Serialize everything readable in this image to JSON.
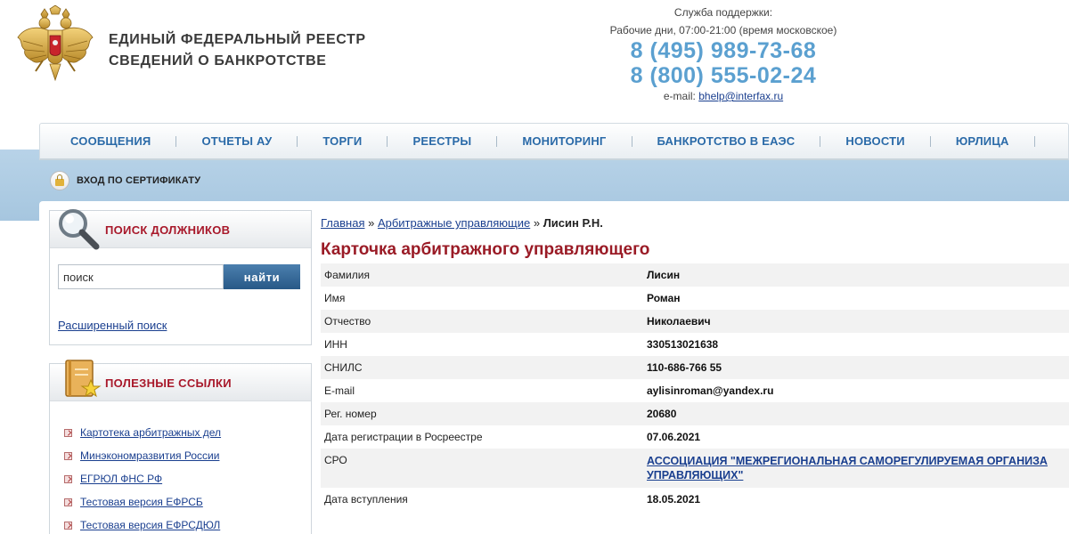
{
  "header": {
    "title_line1": "ЕДИНЫЙ  ФЕДЕРАЛЬНЫЙ  РЕЕСТР",
    "title_line2": "СВЕДЕНИЙ О БАНКРОТСТВЕ",
    "emblem_icon": "double-headed-eagle-icon"
  },
  "support": {
    "label": "Служба поддержки:",
    "hours": "Рабочие дни, 07:00-21:00 (время московское)",
    "phone1": "8 (495) 989-73-68",
    "phone2": "8 (800) 555-02-24",
    "email_label": "e-mail: ",
    "email": "bhelp@interfax.ru",
    "phone_color": "#5ba0d0"
  },
  "nav": {
    "items": [
      {
        "label": "СООБЩЕНИЯ"
      },
      {
        "label": "ОТЧЕТЫ АУ"
      },
      {
        "label": "ТОРГИ"
      },
      {
        "label": "РЕЕСТРЫ"
      },
      {
        "label": "МОНИТОРИНГ"
      },
      {
        "label": "БАНКРОТСТВО В ЕАЭС"
      },
      {
        "label": "НОВОСТИ"
      },
      {
        "label": "ЮРЛИЦА"
      }
    ],
    "link_color": "#2a6aa8"
  },
  "cert": {
    "label": "ВХОД ПО СЕРТИФИКАТУ",
    "icon": "lock-icon"
  },
  "search": {
    "title": "ПОИСК ДОЛЖНИКОВ",
    "icon": "magnifier-icon",
    "input_value": "поиск",
    "button_label": "найти",
    "advanced_link": "Расширенный поиск"
  },
  "links": {
    "title": "ПОЛЕЗНЫЕ ССЫЛКИ",
    "icon": "notebook-star-icon",
    "items": [
      {
        "label": "Картотека арбитражных дел"
      },
      {
        "label": "Минэкономразвития России"
      },
      {
        "label": "ЕГРЮЛ ФНС РФ"
      },
      {
        "label": "Тестовая версия ЕФРСБ"
      },
      {
        "label": "Тестовая версия ЕФРСДЮЛ"
      }
    ]
  },
  "breadcrumb": {
    "home": "Главная",
    "sep": " » ",
    "section": "Арбитражные управляющие",
    "current": "Лисин Р.Н."
  },
  "card": {
    "title": "Карточка арбитражного управляющего",
    "title_color": "#9a1b26",
    "rows": [
      {
        "key": "Фамилия",
        "value": "Лисин"
      },
      {
        "key": "Имя",
        "value": "Роман"
      },
      {
        "key": "Отчество",
        "value": "Николаевич"
      },
      {
        "key": "ИНН",
        "value": "330513021638"
      },
      {
        "key": "СНИЛС",
        "value": "110-686-766 55"
      },
      {
        "key": "E-mail",
        "value": "aylisinroman@yandex.ru"
      },
      {
        "key": "Рег. номер",
        "value": "20680"
      },
      {
        "key": "Дата регистрации в Росреестре",
        "value": "07.06.2021"
      },
      {
        "key": "СРО",
        "value_line1": "АССОЦИАЦИЯ \"МЕЖРЕГИОНАЛЬНАЯ САМОРЕГУЛИРУЕМАЯ ОРГАНИЗА",
        "value_line2": "УПРАВЛЯЮЩИХ\""
      },
      {
        "key": "Дата вступления",
        "value": "18.05.2021"
      }
    ]
  }
}
